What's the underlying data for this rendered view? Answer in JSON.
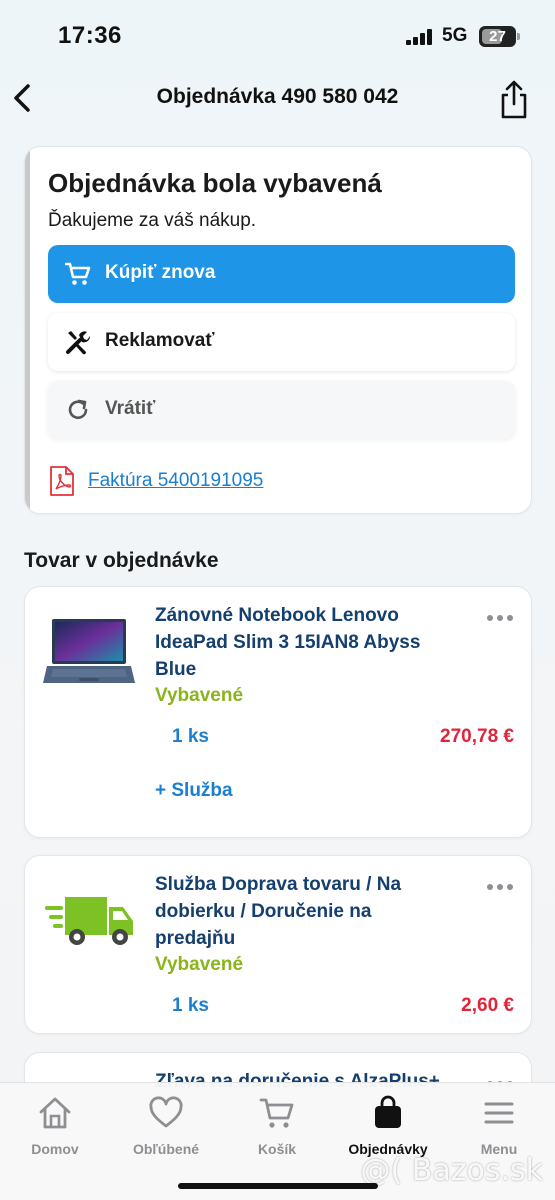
{
  "status_bar": {
    "time": "17:36",
    "network": "5G",
    "battery": "27"
  },
  "header": {
    "title": "Objednávka 490 580 042"
  },
  "status_card": {
    "heading": "Objednávka bola vybavená",
    "subtitle": "Ďakujeme za váš nákup.",
    "buy_again_label": "Kúpiť znova",
    "claim_label": "Reklamovať",
    "return_label": "Vrátiť",
    "invoice_label": "Faktúra 5400191095"
  },
  "items_section": {
    "title": "Tovar v objednávke",
    "items": [
      {
        "name": "Zánovné Notebook Lenovo IdeaPad Slim 3 15IAN8 Abyss Blue",
        "status": "Vybavené",
        "quantity": "1 ks",
        "price": "270,78 €",
        "service_label": "+ Služba",
        "icon": "laptop-image"
      },
      {
        "name": "Služba Doprava tovaru / Na dobierku / Doručenie na predajňu",
        "status": "Vybavené",
        "quantity": "1 ks",
        "price": "2,60 €",
        "icon": "delivery-truck-icon"
      },
      {
        "name": "Zľava na doručenie s AlzaPlus+"
      }
    ]
  },
  "tab_bar": {
    "tabs": [
      {
        "label": "Domov",
        "icon": "home-icon"
      },
      {
        "label": "Obľúbené",
        "icon": "heart-icon"
      },
      {
        "label": "Košík",
        "icon": "cart-icon"
      },
      {
        "label": "Objednávky",
        "icon": "bag-icon"
      },
      {
        "label": "Menu",
        "icon": "menu-icon"
      }
    ],
    "active": "Objednávky"
  },
  "watermark": "@( Bazos.sk",
  "colors": {
    "primary_blue": "#1e95e6",
    "link_blue": "#1a7fd0",
    "status_green": "#8ab31c",
    "price_red": "#e0243a",
    "title_navy": "#143f6e"
  }
}
